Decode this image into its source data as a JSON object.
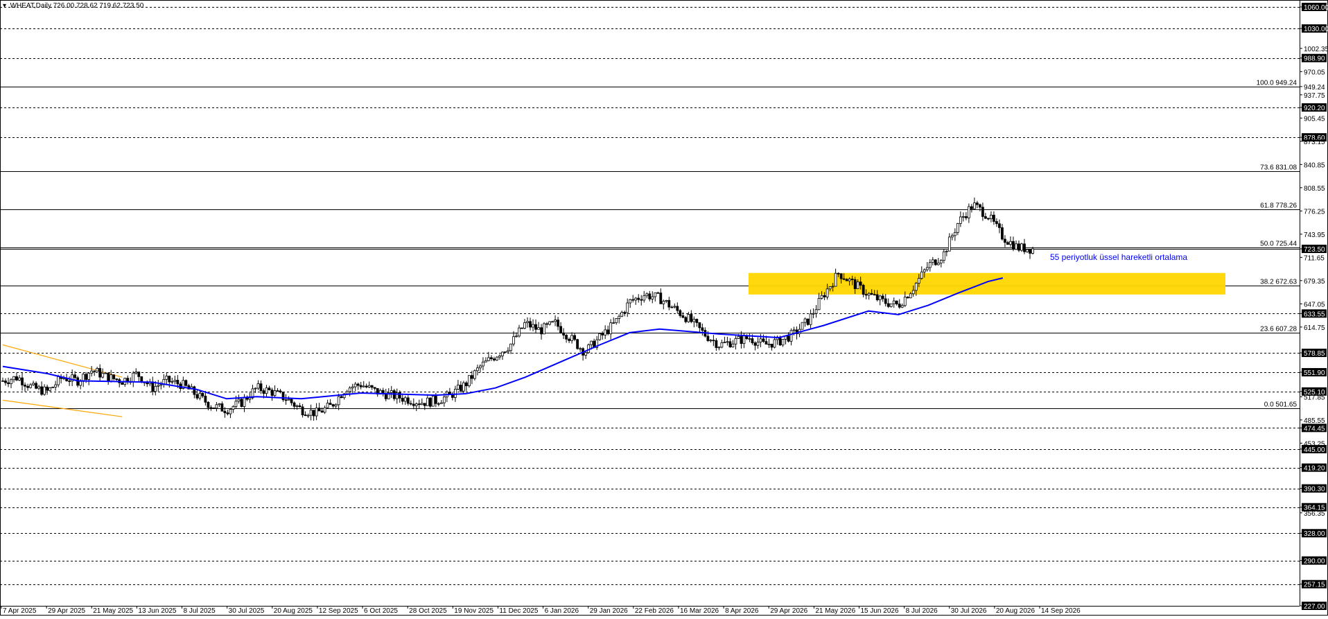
{
  "header": {
    "symbol_line": "▾ .WHEAT,Daily  726.00 728.62 719.62 723.50"
  },
  "colors": {
    "ma_line": "#0000ff",
    "zone_fill": "#ffd700",
    "trend_lines": "#ffa500",
    "label_box": "#000000",
    "candle": "#000000"
  },
  "chart_data": {
    "type": "candlestick",
    "symbol": ".WHEAT",
    "timeframe": "Daily",
    "ohlc_last": {
      "open": 726.0,
      "high": 728.62,
      "low": 719.62,
      "close": 723.5
    },
    "ylim": [
      227.0,
      1060.0
    ],
    "y_ticks": [
      "1060.00",
      "1030.00",
      "1002.35",
      "988.90",
      "970.05",
      "949.24",
      "937.75",
      "920.20",
      "905.45",
      "878.60",
      "873.15",
      "840.85",
      "808.55",
      "776.25",
      "743.95",
      "723.50",
      "711.65",
      "679.35",
      "647.05",
      "633.55",
      "614.75",
      "578.85",
      "551.90",
      "525.10",
      "517.85",
      "485.55",
      "474.45",
      "453.25",
      "445.00",
      "419.20",
      "390.30",
      "364.15",
      "356.35",
      "328.00",
      "290.00",
      "257.15",
      "227.00"
    ],
    "boxed_levels": [
      1060.0,
      1030.0,
      988.9,
      920.2,
      878.6,
      723.5,
      633.55,
      578.85,
      551.9,
      525.1,
      474.45,
      445.0,
      419.2,
      390.3,
      364.15,
      328.0,
      290.0,
      257.15,
      227.0
    ],
    "dashed_levels": [
      1060.0,
      1030.0,
      988.9,
      920.2,
      878.6,
      633.55,
      578.85,
      551.9,
      525.1,
      474.45,
      445.0,
      419.2,
      390.3,
      364.15,
      328.0,
      290.0,
      257.15,
      227.0
    ],
    "current_price_line": 723.5,
    "fibonacci": [
      {
        "label": "100.0 949.24",
        "value": 949.24
      },
      {
        "label": "73.6 831.08",
        "value": 831.08
      },
      {
        "label": "61.8 778.26",
        "value": 778.26
      },
      {
        "label": "50.0 725.44",
        "value": 725.44
      },
      {
        "label": "38.2 672.63",
        "value": 672.63
      },
      {
        "label": "23.6 607.28",
        "value": 607.28
      },
      {
        "label": "0.0 501.65",
        "value": 501.65
      }
    ],
    "x_labels": [
      "7 Apr 2025",
      "29 Apr 2025",
      "21 May 2025",
      "13 Jun 2025",
      "8 Jul 2025",
      "30 Jul 2025",
      "20 Aug 2025",
      "12 Sep 2025",
      "6 Oct 2025",
      "28 Oct 2025",
      "19 Nov 2025",
      "11 Dec 2025",
      "6 Jan 2026",
      "29 Jan 2026",
      "22 Feb 2026",
      "16 Mar 2026",
      "8 Apr 2026",
      "29 Apr 2026",
      "21 May 2026",
      "15 Jun 2026",
      "8 Jul 2026",
      "30 Jul 2026",
      "20 Aug 2026",
      "14 Sep 2026"
    ],
    "price_path": [
      [
        0,
        540
      ],
      [
        1,
        545
      ],
      [
        2,
        530
      ],
      [
        3,
        525
      ],
      [
        4,
        545
      ],
      [
        5,
        540
      ],
      [
        6,
        555
      ],
      [
        7,
        545
      ],
      [
        8,
        540
      ],
      [
        9,
        550
      ],
      [
        10,
        530
      ],
      [
        11,
        540
      ],
      [
        12,
        535
      ],
      [
        13,
        520
      ],
      [
        14,
        505
      ],
      [
        15,
        500
      ],
      [
        16,
        510
      ],
      [
        17,
        530
      ],
      [
        18,
        525
      ],
      [
        19,
        515
      ],
      [
        20,
        500
      ],
      [
        21,
        495
      ],
      [
        22,
        505
      ],
      [
        23,
        530
      ],
      [
        24,
        535
      ],
      [
        25,
        525
      ],
      [
        26,
        520
      ],
      [
        27,
        515
      ],
      [
        28,
        510
      ],
      [
        29,
        512
      ],
      [
        30,
        520
      ],
      [
        31,
        535
      ],
      [
        32,
        560
      ],
      [
        33,
        575
      ],
      [
        34,
        590
      ],
      [
        35,
        620
      ],
      [
        36,
        610
      ],
      [
        37,
        620
      ],
      [
        38,
        600
      ],
      [
        39,
        580
      ],
      [
        40,
        600
      ],
      [
        41,
        620
      ],
      [
        42,
        650
      ],
      [
        43,
        660
      ],
      [
        44,
        655
      ],
      [
        45,
        640
      ],
      [
        46,
        625
      ],
      [
        47,
        605
      ],
      [
        48,
        590
      ],
      [
        49,
        595
      ],
      [
        50,
        600
      ],
      [
        51,
        590
      ],
      [
        52,
        595
      ],
      [
        53,
        605
      ],
      [
        54,
        625
      ],
      [
        55,
        660
      ],
      [
        56,
        690
      ],
      [
        57,
        675
      ],
      [
        58,
        660
      ],
      [
        59,
        650
      ],
      [
        60,
        645
      ],
      [
        61,
        670
      ],
      [
        62,
        700
      ],
      [
        63,
        715
      ],
      [
        64,
        760
      ],
      [
        65,
        785
      ],
      [
        66,
        770
      ],
      [
        67,
        740
      ],
      [
        68,
        725
      ],
      [
        69,
        723.5
      ]
    ],
    "ma_path": [
      [
        0,
        560
      ],
      [
        3,
        550
      ],
      [
        5,
        540
      ],
      [
        10,
        538
      ],
      [
        13,
        528
      ],
      [
        15,
        515
      ],
      [
        17,
        518
      ],
      [
        20,
        515
      ],
      [
        24,
        523
      ],
      [
        29,
        520
      ],
      [
        31,
        522
      ],
      [
        33,
        530
      ],
      [
        35,
        545
      ],
      [
        38,
        572
      ],
      [
        40,
        590
      ],
      [
        42,
        607
      ],
      [
        44,
        612
      ],
      [
        48,
        605
      ],
      [
        52,
        600
      ],
      [
        55,
        617
      ],
      [
        58,
        637
      ],
      [
        60,
        632
      ],
      [
        62,
        645
      ],
      [
        64,
        662
      ],
      [
        66,
        678
      ],
      [
        67,
        683
      ]
    ],
    "moving_average": {
      "label": "55 periyotluk üssel hareketli ortalama",
      "color": "#0000ff",
      "period": 55
    },
    "zone": {
      "low": 660,
      "high": 690,
      "color": "#ffd700"
    },
    "trend_channel": [
      {
        "from": [
          0,
          590
        ],
        "to": [
          8,
          545
        ]
      },
      {
        "from": [
          0,
          513
        ],
        "to": [
          8,
          490
        ]
      }
    ]
  }
}
